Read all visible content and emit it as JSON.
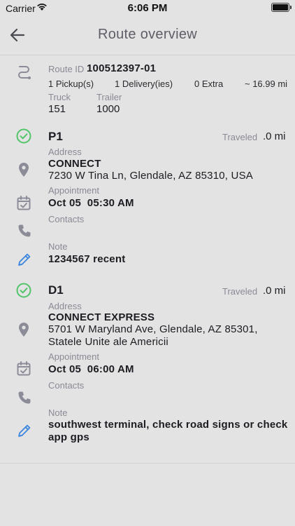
{
  "status_bar": {
    "carrier": "Carrier",
    "time": "6:06 PM"
  },
  "header": {
    "title": "Route overview",
    "back_label": "Back"
  },
  "route": {
    "id_label": "Route ID",
    "id_value": "100512397-01",
    "pickups": "1 Pickup(s)",
    "deliveries": "1 Delivery(ies)",
    "extra": "0 Extra",
    "distance": "~ 16.99 mi",
    "truck_label": "Truck",
    "truck_value": "151",
    "trailer_label": "Trailer",
    "trailer_value": "1000"
  },
  "stops": [
    {
      "name": "P1",
      "traveled_label": "Traveled",
      "traveled_value": ".0 mi",
      "address_label": "Address",
      "address_name": "CONNECT",
      "address_line1": "7230 W Tina Ln, Glendale, AZ 85310, USA",
      "address_line2": "",
      "appointment_label": "Appointment",
      "appointment_value": "Oct 05  05:30 AM",
      "contacts_label": "Contacts",
      "note_label": "Note",
      "note_line1": "1234567 recent",
      "note_line2": ""
    },
    {
      "name": "D1",
      "traveled_label": "Traveled",
      "traveled_value": ".0 mi",
      "address_label": "Address",
      "address_name": "CONNECT EXPRESS",
      "address_line1": "5701 W Maryland Ave, Glendale, AZ 85301,",
      "address_line2": "Statele Unite ale Americii",
      "appointment_label": "Appointment",
      "appointment_value": "Oct 05  06:00 AM",
      "contacts_label": "Contacts",
      "note_label": "Note",
      "note_line1": "southwest terminal, check road signs or check",
      "note_line2": "app gps"
    }
  ],
  "colors": {
    "check": "#52c46a",
    "pencil": "#3a86e0",
    "icon_gray": "#8c8c98"
  }
}
